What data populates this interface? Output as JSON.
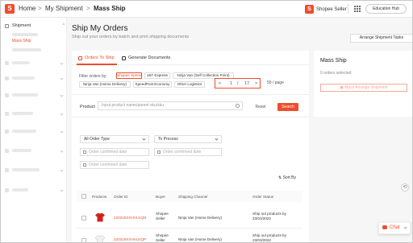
{
  "header": {
    "home": "Home",
    "sep1": ">",
    "crumb1": "My Shipment",
    "sep2": ">",
    "current": "Mass Ship",
    "seller_label": "Shopee Seller",
    "edu_button": "Education Hub",
    "logo_icon": "shopee-bag-icon"
  },
  "sidebar": {
    "section": "Shipment",
    "active_item": "Mass Ship"
  },
  "main": {
    "title": "Ship My Orders",
    "subtitle": "Ship out your orders by batch and print shipping documents",
    "arrange_button": "Arrange Shipment Tasks",
    "tabs": [
      "Orders To Ship",
      "Generate Documents"
    ],
    "filter_label": "Filter orders by:",
    "filters": [
      "Shopee Xpress",
      "J&T Express",
      "Ninja Van (Self Collection Point)",
      "Ninja Van (Home Delivery)",
      "SpeedPost Economy",
      "Other Logistics"
    ],
    "pager": {
      "prev": "<",
      "page": "1",
      "slash": "/",
      "total": "17",
      "next": ">",
      "per_page": "50 / page"
    },
    "product_label": "Product",
    "product_placeholder": "Input product name/parent sku/sku",
    "reset": "Reset",
    "search": "Search",
    "order_type": "All Order Type",
    "process": "To Process",
    "date1": "Order confirmed date",
    "date2": "Order confirmed date",
    "date3": "Order confirmed date",
    "sort": "Sort By",
    "columns": [
      "Products",
      "Order ID",
      "Buyer",
      "Shipping Channel",
      "Order Status"
    ],
    "rows": [
      {
        "order_id": "220318XXHVLKQN",
        "buyer_line1": "Shopee",
        "buyer_line2": "Seller",
        "channel": "Ninja Van (Home Delivery)",
        "status_line1": "Ship out products by",
        "status_line2": "23/03/2022"
      },
      {
        "order_id": "220318XXHVLKQP",
        "buyer_line1": "Shopee",
        "buyer_line2": "Seller",
        "channel": "Ninja Van (Home Delivery)",
        "status_line1": "Ship out products by",
        "status_line2": "23/03/2022"
      }
    ]
  },
  "mass_ship_panel": {
    "title": "Mass Ship",
    "selected": "0 orders selected",
    "button": "Mass Arrange Shipment"
  },
  "chat": {
    "label": "Chat"
  },
  "colors": {
    "brand": "#ee4d2d",
    "background": "#f6f6f6"
  }
}
